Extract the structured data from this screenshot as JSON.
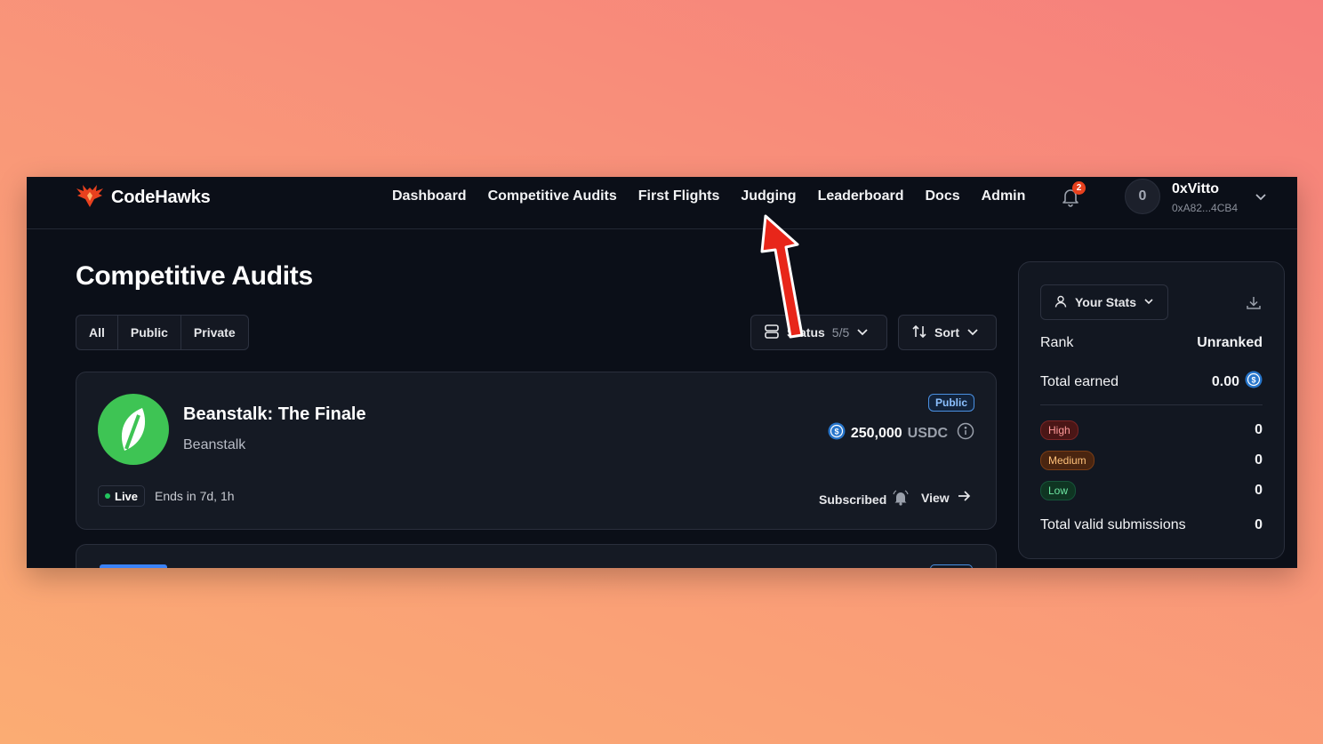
{
  "brand": {
    "name": "CodeHawks"
  },
  "nav": {
    "items": [
      "Dashboard",
      "Competitive Audits",
      "First Flights",
      "Judging",
      "Leaderboard",
      "Docs",
      "Admin"
    ],
    "notification_count": "2"
  },
  "user": {
    "avatar_initial": "0",
    "name": "0xVitto",
    "address": "0xA82...4CB4"
  },
  "page": {
    "title": "Competitive Audits"
  },
  "filters": {
    "all": "All",
    "public": "Public",
    "private": "Private"
  },
  "status_dropdown": {
    "label": "Status",
    "count": "5/5"
  },
  "sort_dropdown": {
    "label": "Sort"
  },
  "audits": [
    {
      "title": "Beanstalk: The Finale",
      "org": "Beanstalk",
      "visibility": "Public",
      "prize_amount": "250,000",
      "prize_unit": "USDC",
      "status": "Live",
      "ends": "Ends in 7d, 1h",
      "subscribed_label": "Subscribed",
      "view_label": "View"
    }
  ],
  "stats": {
    "button_label": "Your Stats",
    "rank_label": "Rank",
    "rank_value": "Unranked",
    "earned_label": "Total earned",
    "earned_value": "0.00",
    "high_label": "High",
    "high_value": "0",
    "medium_label": "Medium",
    "medium_value": "0",
    "low_label": "Low",
    "low_value": "0",
    "valid_label": "Total valid submissions",
    "valid_value": "0"
  },
  "colors": {
    "accent": "#e8411e",
    "live": "#22c55e",
    "usdc": "#2775ca",
    "beanstalk": "#3ec454"
  }
}
